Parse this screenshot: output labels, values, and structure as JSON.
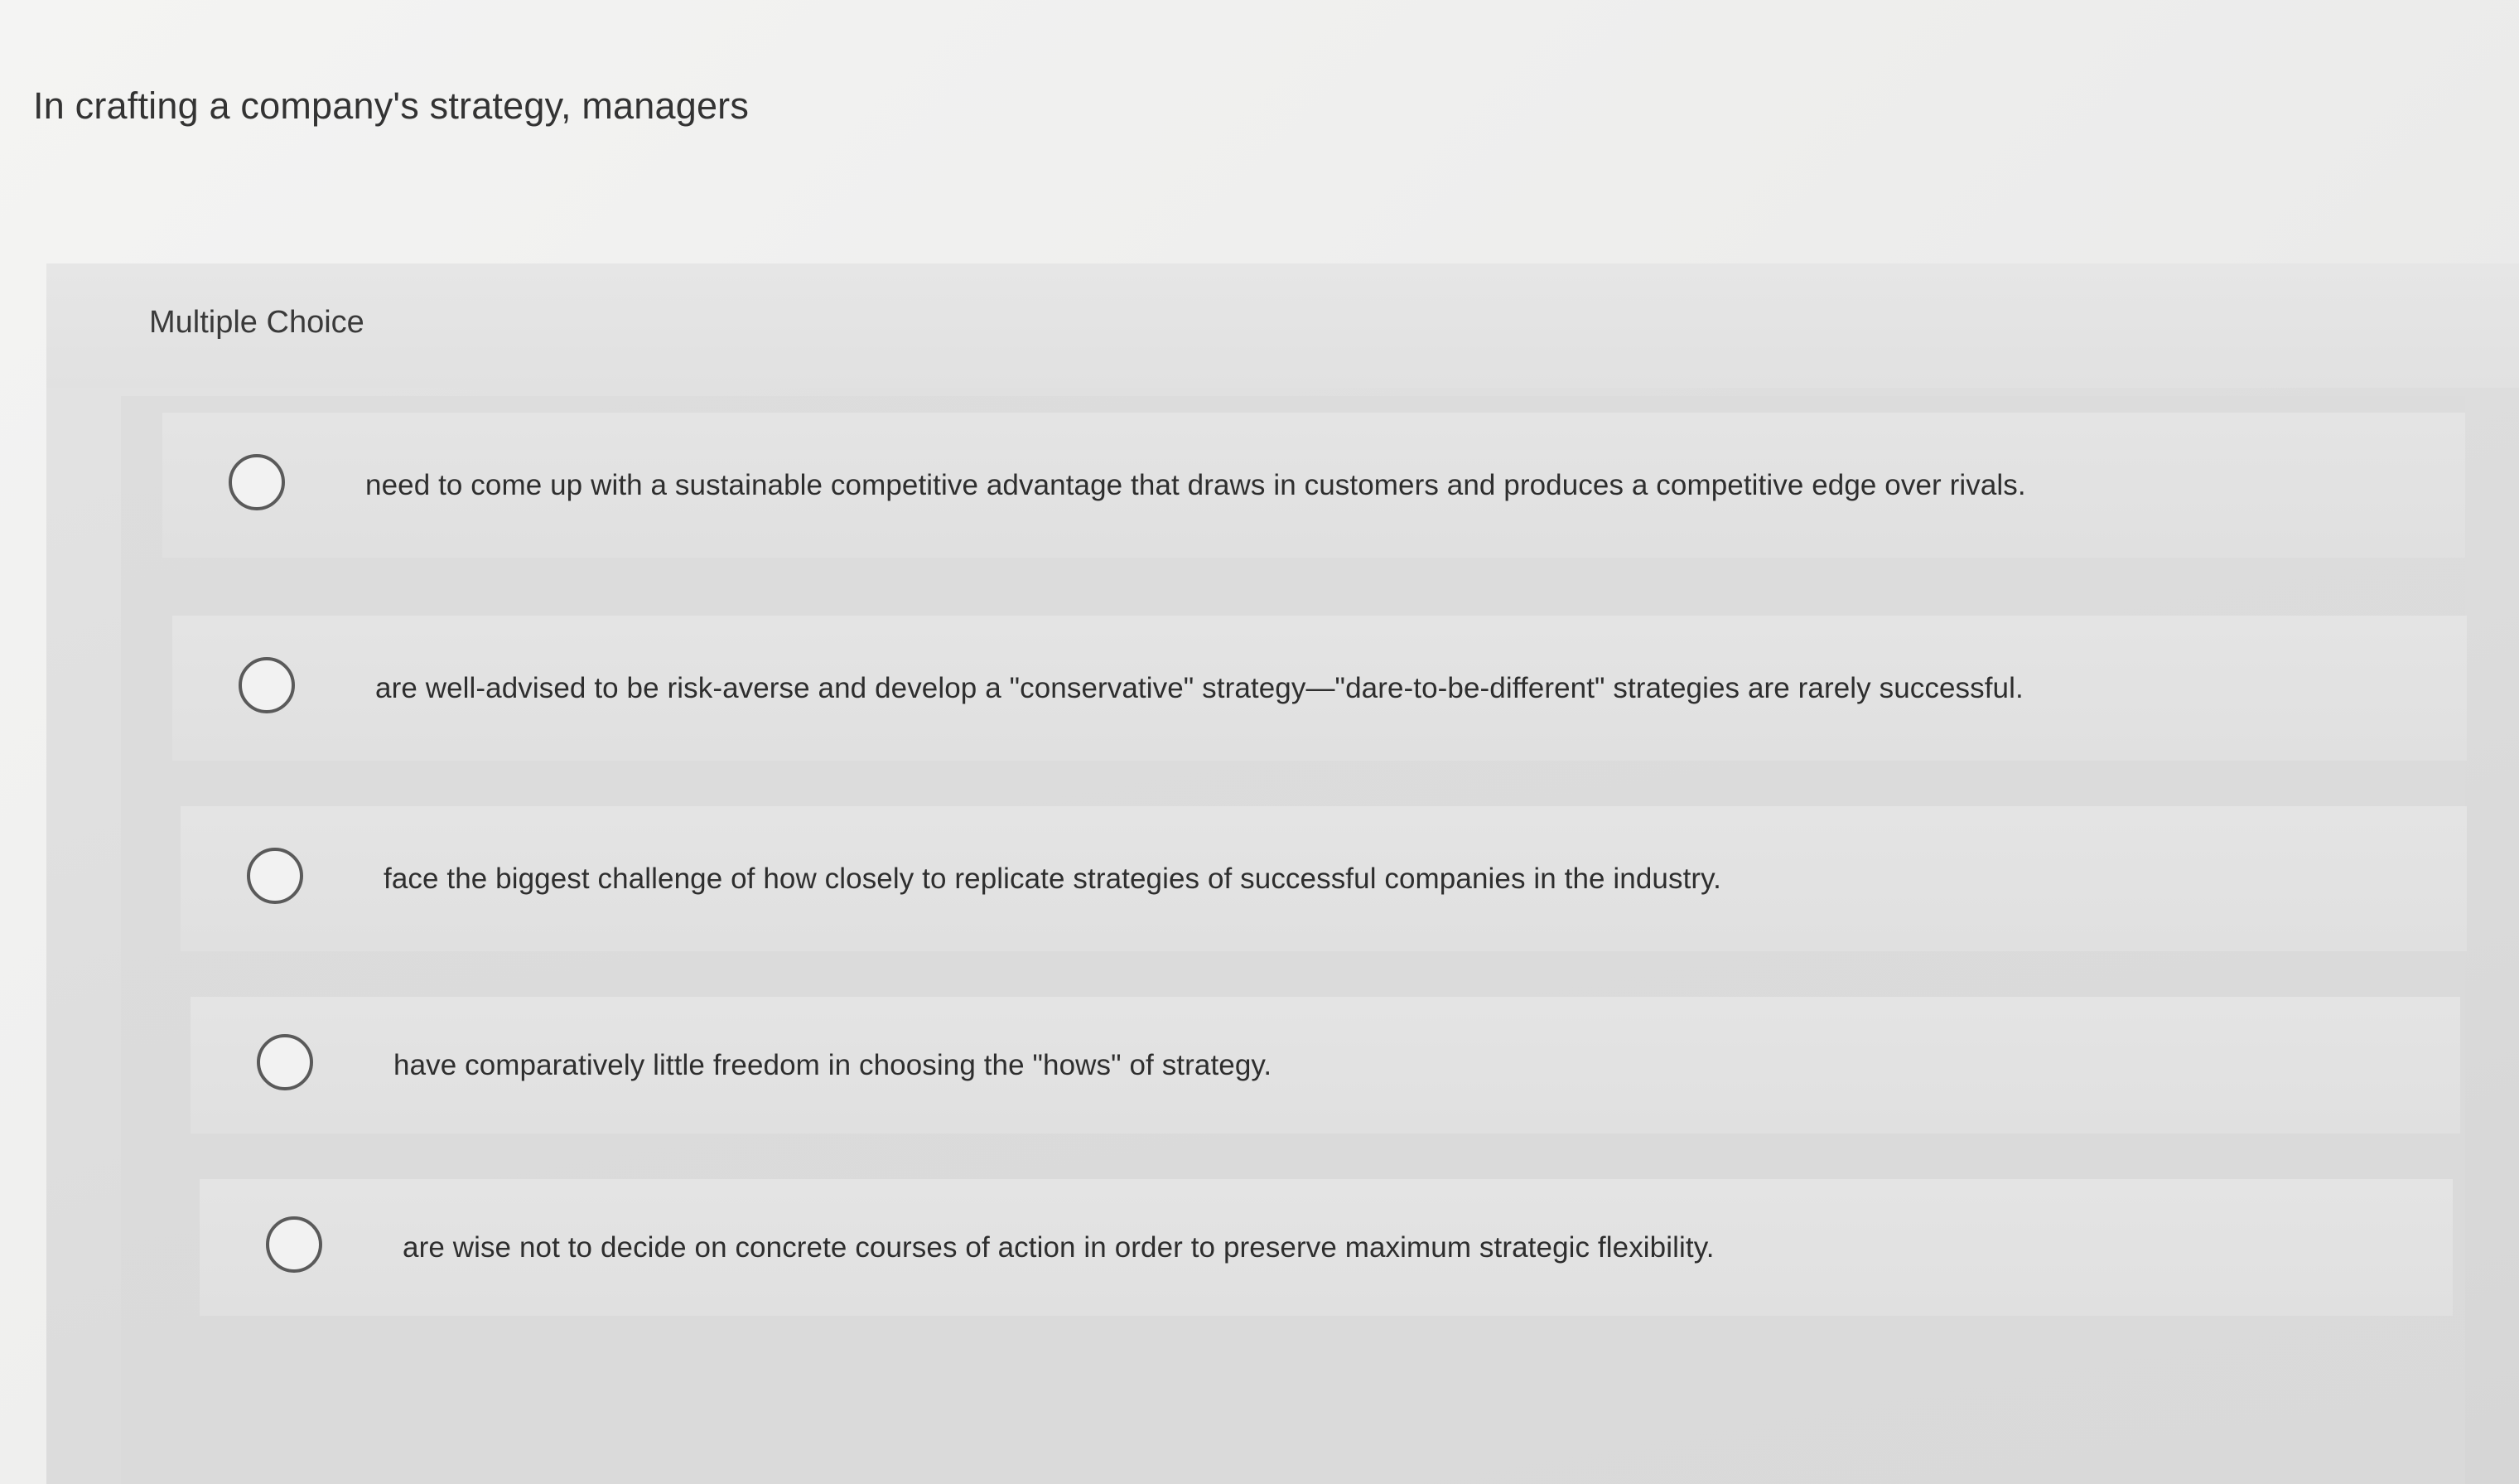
{
  "question": {
    "stem": "In crafting a company's strategy, managers"
  },
  "card": {
    "type_label": "Multiple Choice"
  },
  "options": [
    {
      "label": "need to come up with a sustainable competitive advantage that draws in customers and produces a competitive edge over rivals.",
      "selected": false
    },
    {
      "label": "are well-advised to be risk-averse and develop a \"conservative\" strategy—\"dare-to-be-different\" strategies are rarely successful.",
      "selected": false
    },
    {
      "label": "face the biggest challenge of how closely to replicate strategies of successful companies in the industry.",
      "selected": false
    },
    {
      "label": "have comparatively little freedom in choosing the \"hows\" of strategy.",
      "selected": false
    },
    {
      "label": "are wise not to decide on concrete courses of action in order to preserve maximum strategic flexibility.",
      "selected": false
    }
  ],
  "icons": {
    "radio": "radio-unchecked-icon"
  }
}
